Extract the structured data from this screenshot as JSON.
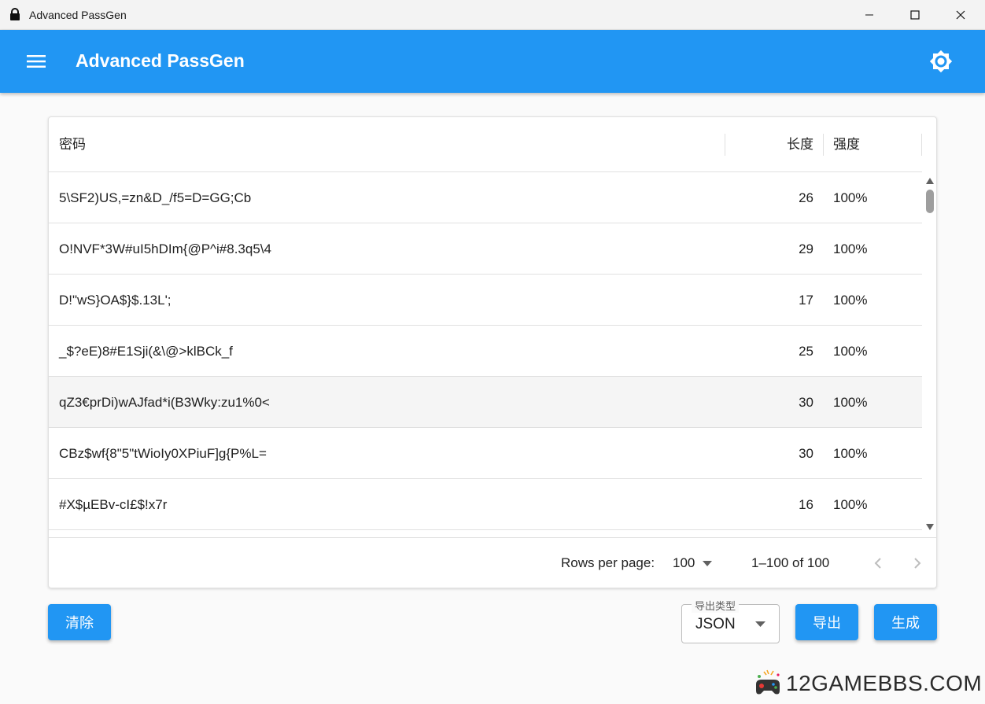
{
  "window": {
    "title": "Advanced PassGen"
  },
  "appbar": {
    "title": "Advanced PassGen"
  },
  "table": {
    "headers": {
      "password": "密码",
      "length": "长度",
      "strength": "强度"
    },
    "rows": [
      {
        "password": "5\\SF2)US,=zn&D_/f5=D=GG;Cb",
        "length": "26",
        "strength": "100%"
      },
      {
        "password": "O!NVF*3W#uI5hDIm{@P^i#8.3q5\\4",
        "length": "29",
        "strength": "100%"
      },
      {
        "password": "D!\"wS}OA$}$.13L';",
        "length": "17",
        "strength": "100%"
      },
      {
        "password": "_$?eE)8#E1Sji(&\\@>klBCk_f",
        "length": "25",
        "strength": "100%"
      },
      {
        "password": "qZ3€prDi)wAJfad*i(B3Wky:zu1%0<",
        "length": "30",
        "strength": "100%"
      },
      {
        "password": "CBz$wf{8\"5\"tWioIy0XPiuF]g{P%L=",
        "length": "30",
        "strength": "100%"
      },
      {
        "password": "#X$µEBv-cI£$!x7r",
        "length": "16",
        "strength": "100%"
      }
    ],
    "footer": {
      "rows_per_page_label": "Rows per page:",
      "rows_per_page_value": "100",
      "range": "1–100 of 100"
    }
  },
  "actions": {
    "clear": "清除",
    "export": "导出",
    "generate": "生成"
  },
  "export_type": {
    "label": "导出类型",
    "value": "JSON"
  },
  "watermark": {
    "text": "12GAMEBBS.COM"
  },
  "colors": {
    "primary": "#2196f3",
    "hover_row": "#f5f5f5"
  }
}
